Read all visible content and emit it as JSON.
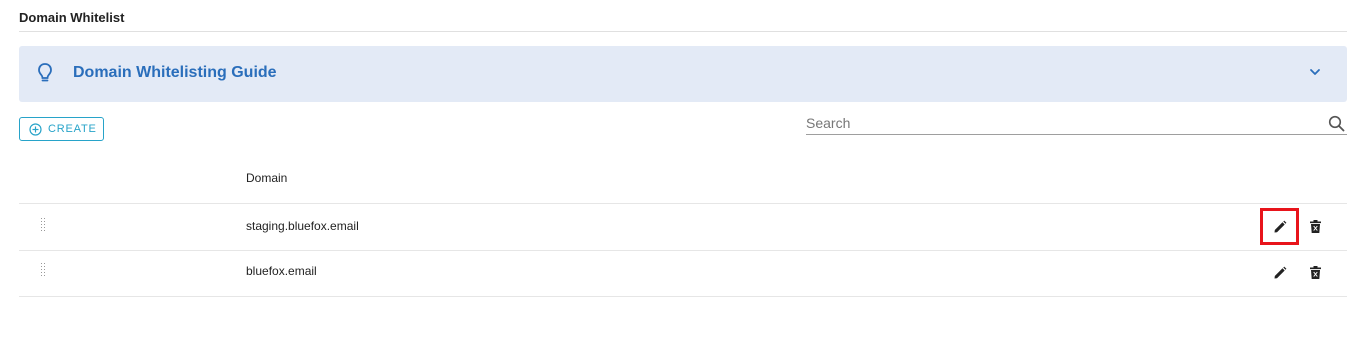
{
  "page": {
    "title": "Domain Whitelist"
  },
  "guide": {
    "title": "Domain Whitelisting Guide",
    "icon": "lightbulb-icon",
    "toggle_icon": "chevron-down-icon",
    "accent": "#2a6ebb"
  },
  "toolbar": {
    "create_label": "CREATE",
    "create_icon": "add-circle-icon",
    "accent": "#27a3c9"
  },
  "search": {
    "placeholder": "Search",
    "value": "",
    "icon": "search-icon"
  },
  "table": {
    "columns": [
      "Domain"
    ],
    "rows": [
      {
        "domain": "staging.bluefox.email",
        "edit_highlighted": true
      },
      {
        "domain": "bluefox.email",
        "edit_highlighted": false
      }
    ],
    "row_actions": [
      "edit-icon",
      "delete-icon"
    ]
  },
  "highlight_color": "#e8141b"
}
